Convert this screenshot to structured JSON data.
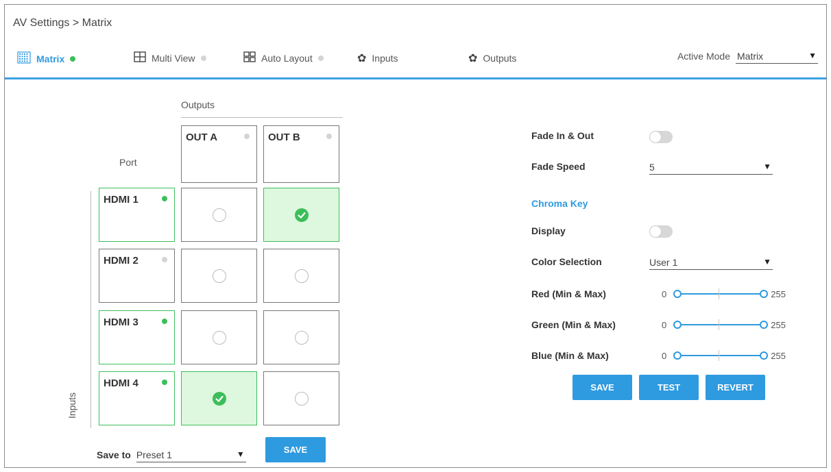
{
  "breadcrumb": "AV Settings > Matrix",
  "colors": {
    "accent": "#2e9ae0",
    "active_dot": "#3cbe5a",
    "inactive_dot": "#d4d4d4",
    "selected_cell": "#def7df"
  },
  "tabs": [
    {
      "label": "Matrix",
      "icon": "matrix-grid-icon",
      "status": "active",
      "selected": true
    },
    {
      "label": "Multi View",
      "icon": "multi-view-icon",
      "status": "inactive",
      "selected": false
    },
    {
      "label": "Auto Layout",
      "icon": "auto-layout-icon",
      "status": "inactive",
      "selected": false
    },
    {
      "label": "Inputs",
      "icon": "gear-icon",
      "selected": false
    },
    {
      "label": "Outputs",
      "icon": "gear-icon",
      "selected": false
    }
  ],
  "active_mode": {
    "label": "Active Mode",
    "value": "Matrix"
  },
  "matrix": {
    "outputs_title": "Outputs",
    "port_label": "Port",
    "inputs_label": "Inputs",
    "outputs": [
      {
        "label": "OUT A",
        "status": "inactive"
      },
      {
        "label": "OUT B",
        "status": "inactive"
      }
    ],
    "inputs": [
      {
        "label": "HDMI 1",
        "status": "active",
        "routes": [
          false,
          true
        ]
      },
      {
        "label": "HDMI 2",
        "status": "inactive",
        "routes": [
          false,
          false
        ]
      },
      {
        "label": "HDMI 3",
        "status": "active",
        "routes": [
          false,
          false
        ]
      },
      {
        "label": "HDMI 4",
        "status": "active",
        "routes": [
          true,
          false
        ]
      }
    ],
    "save_to_label": "Save to",
    "preset_value": "Preset 1",
    "save_button": "SAVE"
  },
  "panel": {
    "fade_in_out": {
      "label": "Fade In & Out",
      "on": false
    },
    "fade_speed": {
      "label": "Fade Speed",
      "value": "5"
    },
    "chroma_key": "Chroma Key",
    "display": {
      "label": "Display",
      "on": false
    },
    "color_selection": {
      "label": "Color Selection",
      "value": "User 1"
    },
    "red": {
      "label": "Red (Min & Max)",
      "min": "0",
      "max": "255"
    },
    "green": {
      "label": "Green (Min & Max)",
      "min": "0",
      "max": "255"
    },
    "blue": {
      "label": "Blue (Min & Max)",
      "min": "0",
      "max": "255"
    },
    "buttons": {
      "save": "SAVE",
      "test": "TEST",
      "revert": "REVERT"
    }
  }
}
